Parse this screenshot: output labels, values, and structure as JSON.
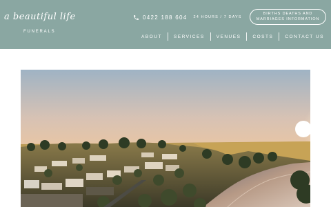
{
  "logo": {
    "script": "a beautiful life",
    "sub": "FUNERALS"
  },
  "contact": {
    "phone": "0422 188 604",
    "hours": "24 HOURS / 7 DAYS"
  },
  "bdm_button": {
    "line1": "BIRTHS DEATHS AND",
    "line2": "MARRIAGES INFORMATION"
  },
  "nav": {
    "about": "ABOUT",
    "services": "SERVICES",
    "venues": "VENUES",
    "costs": "COSTS",
    "contact": "CONTACT US"
  },
  "colors": {
    "header_bg": "#8aa7a2",
    "text": "#ffffff",
    "page_bg": "#ffffff"
  },
  "icons": {
    "phone": "phone-icon"
  }
}
